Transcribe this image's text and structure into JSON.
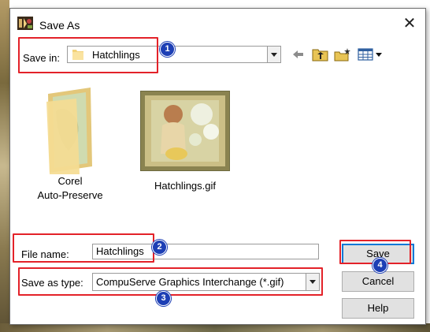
{
  "window": {
    "title": "Save As",
    "close_glyph": "✕"
  },
  "location": {
    "label": "Save in:",
    "value": "Hatchlings"
  },
  "toolbar": {
    "icons": [
      "back-arrow-icon",
      "up-folder-icon",
      "new-folder-icon",
      "view-menu-icon"
    ]
  },
  "files": [
    {
      "name_line1": "Corel",
      "name_line2": "Auto-Preserve",
      "type": "folder"
    },
    {
      "name_line1": "Hatchlings.gif",
      "name_line2": "",
      "type": "gif-thumbnail"
    }
  ],
  "filename": {
    "label": "File name:",
    "value": "Hatchlings"
  },
  "filetype": {
    "label": "Save as type:",
    "value": "CompuServe Graphics Interchange (*.gif)"
  },
  "buttons": {
    "save": "Save",
    "cancel": "Cancel",
    "help": "Help"
  },
  "callouts": [
    "1",
    "2",
    "3",
    "4"
  ],
  "colors": {
    "highlight": "#e32229",
    "badge": "#1d3fb5",
    "default_button_border": "#0078d7"
  }
}
